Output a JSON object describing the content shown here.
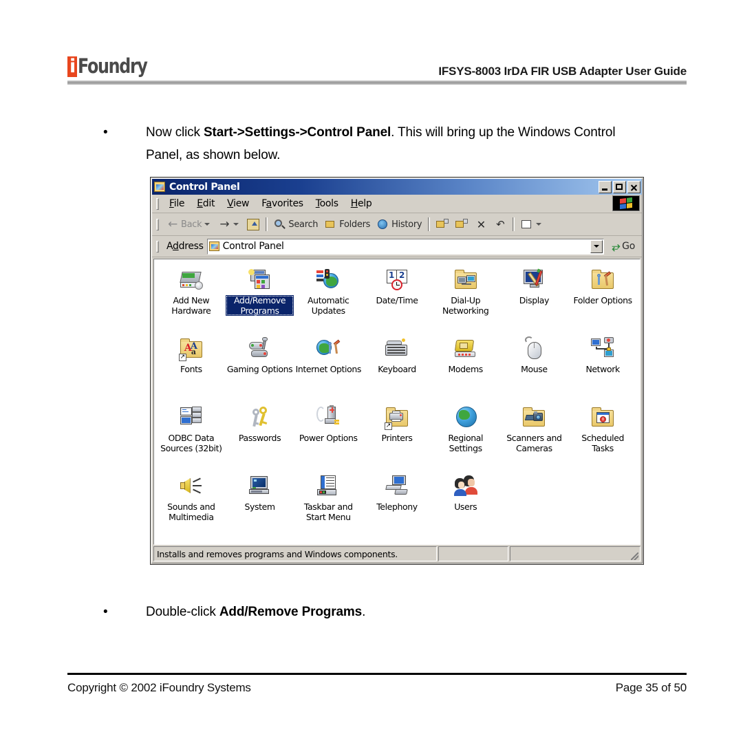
{
  "header": {
    "logo_mark": "i",
    "logo_word": "Foundry",
    "title": "IFSYS-8003 IrDA FIR USB Adapter User Guide"
  },
  "bullets": [
    {
      "marker": "•",
      "segments": [
        {
          "text": "Now click ",
          "bold": false
        },
        {
          "text": "Start->Settings->Control Panel",
          "bold": true
        },
        {
          "text": ". This will bring up the Windows Control Panel, as shown below.",
          "bold": false
        }
      ]
    },
    {
      "marker": "•",
      "segments": [
        {
          "text": "Double-click ",
          "bold": false
        },
        {
          "text": "Add/Remove Programs",
          "bold": true
        },
        {
          "text": ".",
          "bold": false
        }
      ]
    }
  ],
  "window": {
    "title": "Control Panel",
    "title_icon": "control-panel-icon",
    "window_buttons": [
      {
        "name": "minimize-button",
        "glyph": "minimize-icon"
      },
      {
        "name": "maximize-button",
        "glyph": "maximize-icon"
      },
      {
        "name": "close-button",
        "glyph": "close-icon"
      }
    ],
    "menu": [
      {
        "accel": "F",
        "rest": "ile",
        "label": "File"
      },
      {
        "accel": "E",
        "rest": "dit",
        "label": "Edit"
      },
      {
        "accel": "V",
        "rest": "iew",
        "label": "View"
      },
      {
        "pre": "F",
        "accel": "a",
        "rest": "vorites",
        "label": "Favorites"
      },
      {
        "accel": "T",
        "rest": "ools",
        "label": "Tools"
      },
      {
        "accel": "H",
        "rest": "elp",
        "label": "Help"
      }
    ],
    "menu_brand_icon": "windows-flag-icon",
    "toolbar": [
      {
        "name": "back-button",
        "label": "Back",
        "icon": "arrow-left-icon",
        "has_caret": true,
        "disabled": true
      },
      {
        "name": "forward-button",
        "label": "",
        "icon": "arrow-right-icon",
        "has_caret": true,
        "disabled": false
      },
      {
        "name": "up-button",
        "label": "",
        "icon": "folder-up-icon",
        "has_caret": false,
        "disabled": false
      },
      {
        "separator": true
      },
      {
        "name": "search-button",
        "label": "Search",
        "icon": "search-icon",
        "has_caret": false,
        "disabled": false
      },
      {
        "name": "folders-button",
        "label": "Folders",
        "icon": "folders-icon",
        "has_caret": false,
        "disabled": false
      },
      {
        "name": "history-button",
        "label": "History",
        "icon": "history-icon",
        "has_caret": false,
        "disabled": false
      },
      {
        "separator": true
      },
      {
        "name": "move-to-button",
        "label": "",
        "icon": "move-to-folder-icon",
        "has_caret": false,
        "disabled": false
      },
      {
        "name": "copy-to-button",
        "label": "",
        "icon": "copy-to-folder-icon",
        "has_caret": false,
        "disabled": false
      },
      {
        "name": "delete-button",
        "label": "",
        "icon": "delete-x-icon",
        "has_caret": false,
        "disabled": false
      },
      {
        "name": "undo-button",
        "label": "",
        "icon": "undo-icon",
        "has_caret": false,
        "disabled": false
      },
      {
        "separator": true
      },
      {
        "name": "views-button",
        "label": "",
        "icon": "views-icon",
        "has_caret": true,
        "disabled": false
      }
    ],
    "address": {
      "label_pre": "A",
      "label_accel": "d",
      "label_rest": "dress",
      "label": "Address",
      "icon": "control-panel-icon",
      "value": "Control Panel",
      "go_label": "Go",
      "go_icon": "go-arrow-icon",
      "dropdown_icon": "chevron-down-icon"
    },
    "items": [
      {
        "label": "Add New Hardware",
        "icon": "add-new-hardware-icon",
        "selected": false
      },
      {
        "label": "Add/Remove Programs",
        "icon": "add-remove-programs-icon",
        "selected": true
      },
      {
        "label": "Automatic Updates",
        "icon": "automatic-updates-icon",
        "selected": false
      },
      {
        "label": "Date/Time",
        "icon": "date-time-icon",
        "selected": false
      },
      {
        "label": "Dial-Up Networking",
        "icon": "dial-up-networking-icon",
        "selected": false
      },
      {
        "label": "Display",
        "icon": "display-icon",
        "selected": false
      },
      {
        "label": "Folder Options",
        "icon": "folder-options-icon",
        "selected": false
      },
      {
        "label": "Fonts",
        "icon": "fonts-icon",
        "selected": false
      },
      {
        "label": "Gaming Options",
        "icon": "gaming-options-icon",
        "selected": false
      },
      {
        "label": "Internet Options",
        "icon": "internet-options-icon",
        "selected": false
      },
      {
        "label": "Keyboard",
        "icon": "keyboard-icon",
        "selected": false
      },
      {
        "label": "Modems",
        "icon": "modems-icon",
        "selected": false
      },
      {
        "label": "Mouse",
        "icon": "mouse-icon",
        "selected": false
      },
      {
        "label": "Network",
        "icon": "network-icon",
        "selected": false
      },
      {
        "label": "ODBC Data Sources (32bit)",
        "icon": "odbc-data-sources-icon",
        "selected": false
      },
      {
        "label": "Passwords",
        "icon": "passwords-icon",
        "selected": false
      },
      {
        "label": "Power Options",
        "icon": "power-options-icon",
        "selected": false
      },
      {
        "label": "Printers",
        "icon": "printers-icon",
        "selected": false
      },
      {
        "label": "Regional Settings",
        "icon": "regional-settings-icon",
        "selected": false
      },
      {
        "label": "Scanners and Cameras",
        "icon": "scanners-and-cameras-icon",
        "selected": false
      },
      {
        "label": "Scheduled Tasks",
        "icon": "scheduled-tasks-icon",
        "selected": false
      },
      {
        "label": "Sounds and Multimedia",
        "icon": "sounds-and-multimedia-icon",
        "selected": false
      },
      {
        "label": "System",
        "icon": "system-icon",
        "selected": false
      },
      {
        "label": "Taskbar and Start Menu",
        "icon": "taskbar-start-menu-icon",
        "selected": false
      },
      {
        "label": "Telephony",
        "icon": "telephony-icon",
        "selected": false
      },
      {
        "label": "Users",
        "icon": "users-icon",
        "selected": false
      }
    ],
    "statusbar": {
      "message": "Installs and removes programs and Windows components.",
      "pane2": "",
      "pane3": ""
    }
  },
  "footer": {
    "copyright": "Copyright © 2002 iFoundry Systems",
    "page": "Page 35 of 50"
  },
  "colors": {
    "accent_orange": "#E8461E",
    "title_bar_dark": "#0A246A",
    "title_bar_light": "#A6CAF0",
    "window_face": "#D4D0C8",
    "selection_blue": "#0A246A"
  }
}
